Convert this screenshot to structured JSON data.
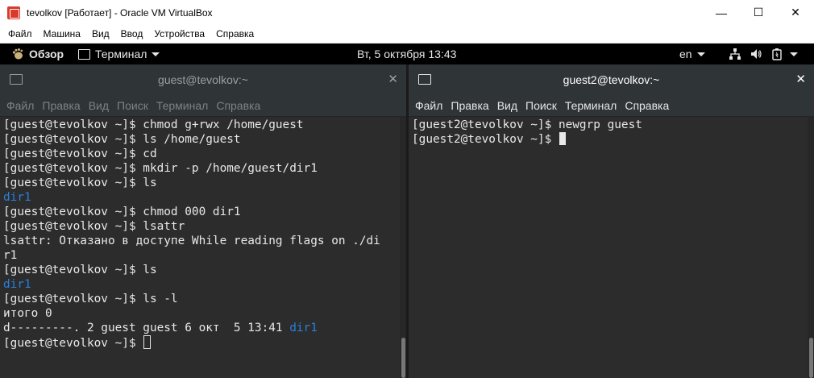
{
  "window": {
    "title": "tevolkov [Работает] - Oracle VM VirtualBox",
    "controls": {
      "minimize": "—",
      "maximize": "☐",
      "close": "✕"
    }
  },
  "vbox_menu": [
    "Файл",
    "Машина",
    "Вид",
    "Ввод",
    "Устройства",
    "Справка"
  ],
  "topbar": {
    "activities": "Обзор",
    "app": "Терминал",
    "clock": "Вт, 5 октября  13:43",
    "lang": "en"
  },
  "terminal_left": {
    "title": "guest@tevolkov:~",
    "menu": [
      "Файл",
      "Правка",
      "Вид",
      "Поиск",
      "Терминал",
      "Справка"
    ],
    "lines": [
      {
        "text": "[guest@tevolkov ~]$ chmod g+rwx /home/guest"
      },
      {
        "text": "[guest@tevolkov ~]$ ls /home/guest"
      },
      {
        "text": "[guest@tevolkov ~]$ cd"
      },
      {
        "text": "[guest@tevolkov ~]$ mkdir -p /home/guest/dir1"
      },
      {
        "text": "[guest@tevolkov ~]$ ls"
      },
      {
        "text": "dir1",
        "color": "blue"
      },
      {
        "text": "[guest@tevolkov ~]$ chmod 000 dir1"
      },
      {
        "text": "[guest@tevolkov ~]$ lsattr"
      },
      {
        "text": "lsattr: Отказано в доступе While reading flags on ./di"
      },
      {
        "text": "r1"
      },
      {
        "text": "[guest@tevolkov ~]$ ls"
      },
      {
        "text": "dir1",
        "color": "blue"
      },
      {
        "text": "[guest@tevolkov ~]$ ls -l"
      },
      {
        "text": "итого 0"
      },
      {
        "text": "d---------. 2 guest guest 6 окт  5 13:41 ",
        "suffix": "dir1"
      },
      {
        "text": "[guest@tevolkov ~]$ ",
        "cursor": "hollow"
      }
    ]
  },
  "terminal_right": {
    "title": "guest2@tevolkov:~",
    "menu": [
      "Файл",
      "Правка",
      "Вид",
      "Поиск",
      "Терминал",
      "Справка"
    ],
    "lines": [
      {
        "text": "[guest2@tevolkov ~]$ newgrp guest"
      },
      {
        "text": "[guest2@tevolkov ~]$ ",
        "cursor": "solid"
      }
    ]
  },
  "colors": {
    "link_blue": "#2a7fde",
    "terminal_bg": "#2c2c2c",
    "header_bg": "#2f3436"
  }
}
